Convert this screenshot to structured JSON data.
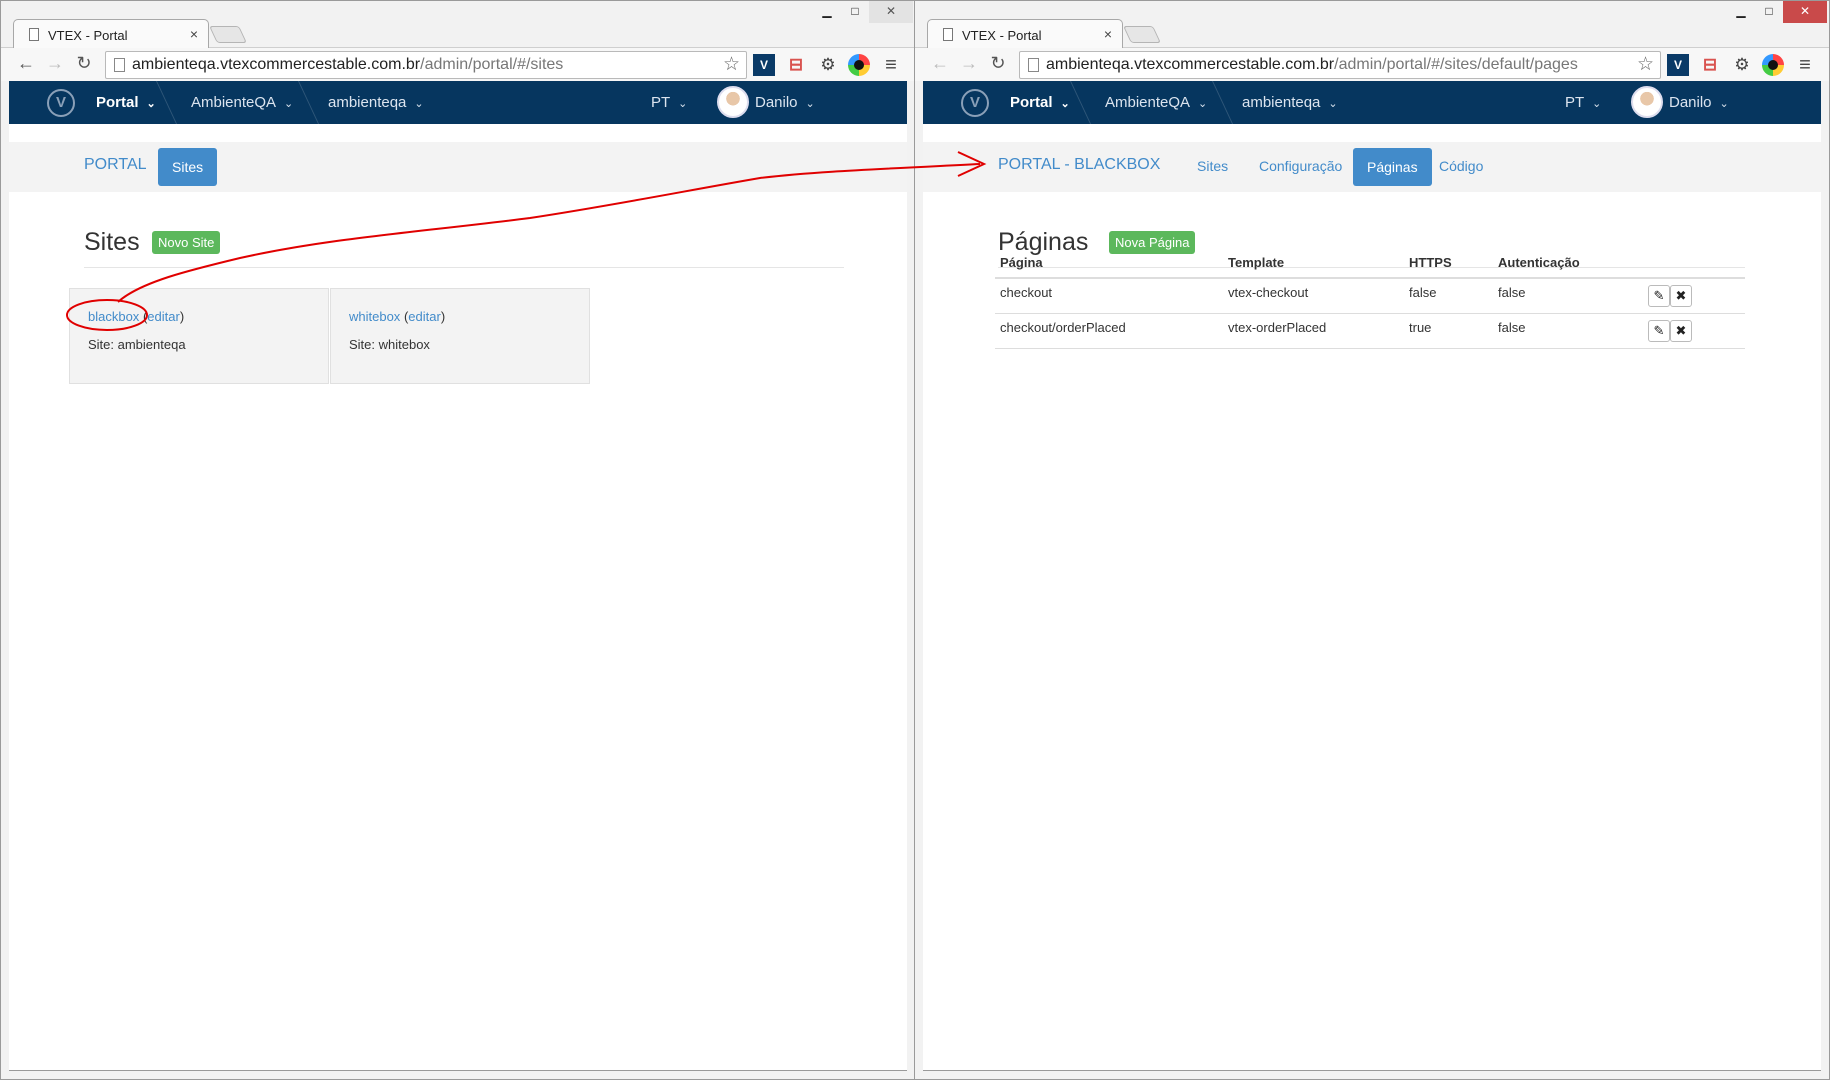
{
  "left": {
    "tab_title": "VTEX - Portal",
    "url_host": "ambienteqa.vtexcommercestable.com.br",
    "url_path": "/admin/portal/#/sites",
    "appbar": {
      "portal": "Portal",
      "account": "AmbienteQA",
      "store": "ambienteqa",
      "lang": "PT",
      "user": "Danilo"
    },
    "subnav": {
      "brand": "PORTAL",
      "sites": "Sites"
    },
    "heading": "Sites",
    "new_button": "Novo Site",
    "cards": [
      {
        "name": "blackbox",
        "edit": "editar",
        "site_label": "Site: ambienteqa"
      },
      {
        "name": "whitebox",
        "edit": "editar",
        "site_label": "Site: whitebox"
      }
    ]
  },
  "right": {
    "tab_title": "VTEX - Portal",
    "url_host": "ambienteqa.vtexcommercestable.com.br",
    "url_path": "/admin/portal/#/sites/default/pages",
    "appbar": {
      "portal": "Portal",
      "account": "AmbienteQA",
      "store": "ambienteqa",
      "lang": "PT",
      "user": "Danilo"
    },
    "subnav": {
      "brand": "PORTAL - BLACKBOX",
      "sites": "Sites",
      "config": "Configuração",
      "pages": "Páginas",
      "code": "Código"
    },
    "heading": "Páginas",
    "new_button": "Nova Página",
    "table": {
      "headers": [
        "Página",
        "Template",
        "HTTPS",
        "Autenticação"
      ],
      "rows": [
        {
          "page": "checkout",
          "template": "vtex-checkout",
          "https": "false",
          "auth": "false"
        },
        {
          "page": "checkout/orderPlaced",
          "template": "vtex-orderPlaced",
          "https": "true",
          "auth": "false"
        }
      ]
    }
  },
  "colors": {
    "navbar": "#06365f",
    "primary": "#428bca",
    "success": "#5cb85c",
    "annotation": "#e00000"
  },
  "icons": [
    "page-icon",
    "back-icon",
    "forward-icon",
    "reload-icon",
    "star-icon",
    "gear-icon",
    "menu-icon",
    "vtex-logo-icon",
    "edit-icon",
    "delete-icon"
  ]
}
